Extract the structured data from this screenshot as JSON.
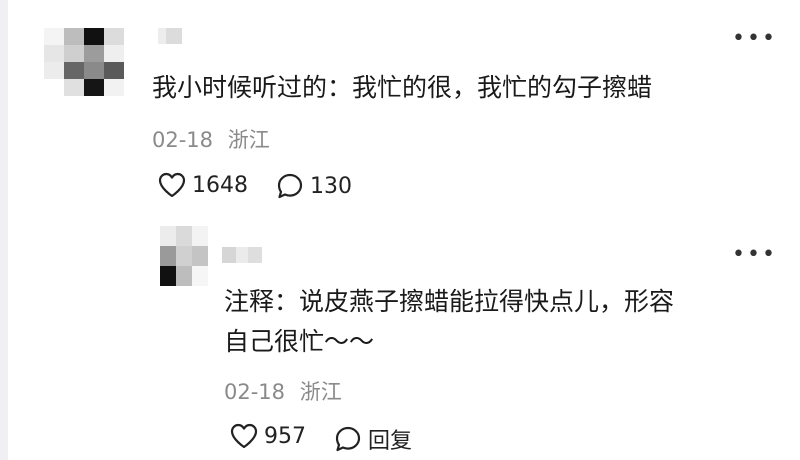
{
  "comment": {
    "text": "我小时候听过的：我忙的很，我忙的勾子擦蜡",
    "date": "02-18",
    "location": "浙江",
    "likes": "1648",
    "replies": "130",
    "more_icon": "more-dots-icon"
  },
  "reply": {
    "text_line1": "注释：说皮燕子擦蜡能拉得快点儿，形容",
    "text_line2": "自己很忙～～",
    "date": "02-18",
    "location": "浙江",
    "likes": "957",
    "reply_label": "回复",
    "more_icon": "more-dots-icon"
  }
}
